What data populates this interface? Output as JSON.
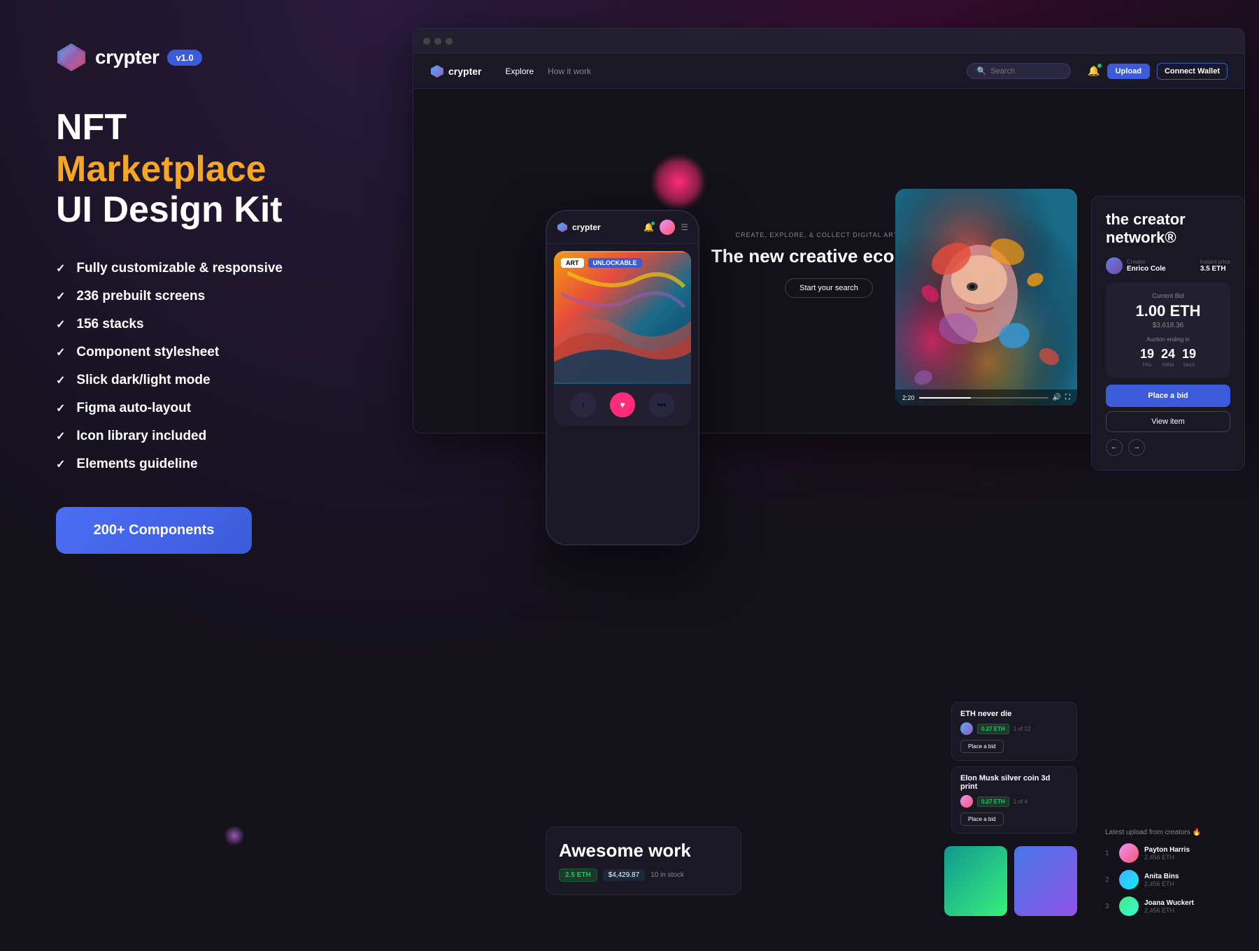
{
  "app": {
    "name": "crypter",
    "version": "v1.0",
    "logo_alt": "crypter logo diamond"
  },
  "left_panel": {
    "headline_line1": "NFT ",
    "headline_marketplace": "Marketplace",
    "headline_line2": "UI Design Kit",
    "features": [
      {
        "text": "Fully customizable & responsive"
      },
      {
        "text": "236 prebuilt screens"
      },
      {
        "text": "156 stacks"
      },
      {
        "text": "Component stylesheet"
      },
      {
        "text": "Slick dark/light mode"
      },
      {
        "text": "Figma auto-layout"
      },
      {
        "text": "Icon library included"
      },
      {
        "text": "Elements guideline"
      }
    ],
    "cta_label": "200+ Components"
  },
  "browser": {
    "navbar": {
      "logo": "crypter",
      "links": [
        "Explore",
        "How it work"
      ],
      "search_placeholder": "Search",
      "upload_label": "Upload",
      "connect_wallet_label": "Connect Wallet"
    },
    "hero": {
      "subtitle": "CREATE, EXPLORE, & COLLECT DIGITAL ART NFTS.",
      "title": "The new creative economy.",
      "search_btn": "Start your search"
    }
  },
  "creator_panel": {
    "title": "the creator network®",
    "creator_label": "Creator",
    "creator_name": "Enrico Cole",
    "instant_price_label": "instant price",
    "instant_price": "3.5 ETH",
    "current_bid_label": "Current Bid",
    "bid_amount": "1.00 ETH",
    "bid_usd": "$3,618.36",
    "auction_label": "Auction ending in",
    "timer": {
      "hours": "19",
      "mins": "24",
      "secs": "19",
      "hours_label": "Hrs",
      "mins_label": "mins",
      "secs_label": "secs"
    },
    "place_bid_label": "Place a bid",
    "view_item_label": "View item"
  },
  "mobile": {
    "logo": "crypter",
    "nft_tags": [
      "ART",
      "UNLOCKABLE"
    ]
  },
  "artwork_card": {
    "title": "Awesome work",
    "eth": "2.5 ETH",
    "price": "$4,429.87",
    "stock": "10 in stock"
  },
  "eth_listings": [
    {
      "title": "ETH never die",
      "eth": "0.27 ETH",
      "of": "1 of 12",
      "bid_label": "Place a bid"
    },
    {
      "title": "Elon Musk silver coin 3d print",
      "eth": "0.27 ETH",
      "of": "1 of 4",
      "bid_label": "Place a bid"
    }
  ],
  "creators": {
    "title": "Latest upload from creators 🔥",
    "list": [
      {
        "rank": "1",
        "name": "Payton Harris",
        "eth": "2,456 ETH"
      },
      {
        "rank": "2",
        "name": "Anita Bins",
        "eth": "2,456 ETH"
      },
      {
        "rank": "3",
        "name": "Joana Wuckert",
        "eth": "2,456 ETH"
      }
    ]
  }
}
